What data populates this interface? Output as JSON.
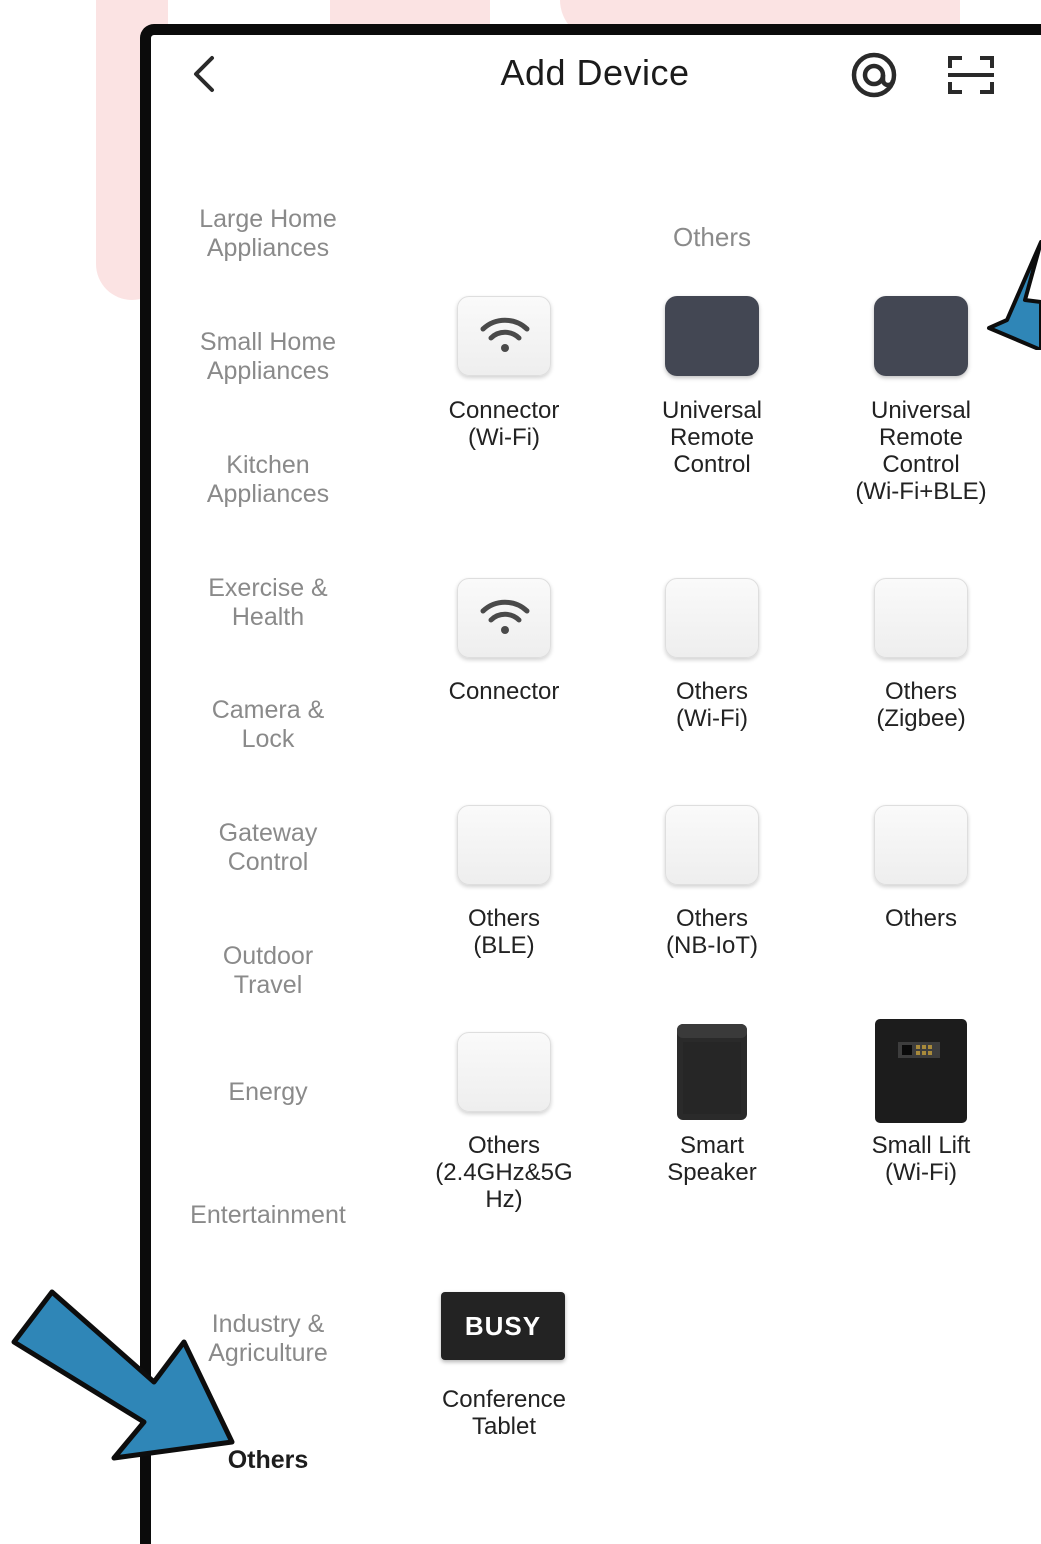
{
  "header": {
    "title": "Add Device",
    "back_icon": "chevron-left-icon",
    "at_icon": "at-sign-icon",
    "scan_icon": "scan-icon"
  },
  "sidebar": {
    "items": [
      {
        "label": "Large Home\nAppliances",
        "active": false
      },
      {
        "label": "Small Home\nAppliances",
        "active": false
      },
      {
        "label": "Kitchen\nAppliances",
        "active": false
      },
      {
        "label": "Exercise &\nHealth",
        "active": false
      },
      {
        "label": "Camera &\nLock",
        "active": false
      },
      {
        "label": "Gateway\nControl",
        "active": false
      },
      {
        "label": "Outdoor\nTravel",
        "active": false
      },
      {
        "label": "Energy",
        "active": false
      },
      {
        "label": "Entertainment",
        "active": false
      },
      {
        "label": "Industry &\nAgriculture",
        "active": false
      },
      {
        "label": "Others",
        "active": true
      }
    ]
  },
  "main": {
    "section_title": "Others",
    "devices": [
      {
        "label": "Connector\n(Wi-Fi)",
        "icon": "wifi-icon"
      },
      {
        "label": "Universal\nRemote\nControl",
        "icon": "remote-icon"
      },
      {
        "label": "Universal\nRemote\nControl\n(Wi-Fi+BLE)",
        "icon": "remote-icon"
      },
      {
        "label": "Connector",
        "icon": "wifi-icon"
      },
      {
        "label": "Others\n(Wi-Fi)",
        "icon": "blank-device-icon"
      },
      {
        "label": "Others\n(Zigbee)",
        "icon": "blank-device-icon"
      },
      {
        "label": "Others\n(BLE)",
        "icon": "blank-device-icon"
      },
      {
        "label": "Others\n(NB-IoT)",
        "icon": "blank-device-icon"
      },
      {
        "label": "Others",
        "icon": "blank-device-icon"
      },
      {
        "label": "Others\n(2.4GHz&5G\nHz)",
        "icon": "blank-device-icon"
      },
      {
        "label": "Smart\nSpeaker",
        "icon": "speaker-icon"
      },
      {
        "label": "Small Lift\n(Wi-Fi)",
        "icon": "safe-box-icon"
      },
      {
        "label": "Conference\nTablet",
        "icon": "busy-sign-icon",
        "badge": "BUSY"
      }
    ]
  },
  "colors": {
    "accent_arrow": "#2f86b7",
    "background_pink": "#fbe3e3",
    "frame": "#0b0b0b"
  }
}
